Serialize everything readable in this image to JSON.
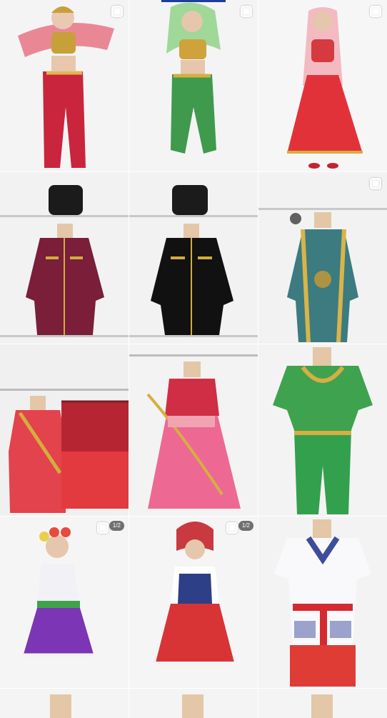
{
  "grid": {
    "tiles": [
      {
        "id": "t1",
        "subject": "girl-red-belly-dance-costume",
        "multi": true,
        "counter": ""
      },
      {
        "id": "t2",
        "subject": "girl-green-belly-dance-costume",
        "multi": true,
        "counter": ""
      },
      {
        "id": "t3",
        "subject": "girl-red-skirt-oriental-costume",
        "multi": true,
        "counter": ""
      },
      {
        "id": "t4",
        "subject": "burgundy-caucasian-coat-with-hat",
        "multi": false,
        "counter": ""
      },
      {
        "id": "t5",
        "subject": "black-caucasian-coat-with-hat",
        "multi": false,
        "counter": ""
      },
      {
        "id": "t6",
        "subject": "teal-gold-embroidered-robe",
        "multi": true,
        "counter": ""
      },
      {
        "id": "t7",
        "subject": "red-dresses-on-rack",
        "multi": false,
        "counter": ""
      },
      {
        "id": "t8",
        "subject": "pink-tulle-dress-mannequin",
        "multi": false,
        "counter": ""
      },
      {
        "id": "t9",
        "subject": "green-sequin-costume",
        "multi": false,
        "counter": ""
      },
      {
        "id": "t10",
        "subject": "girl-ukrainian-purple-skirt",
        "multi": true,
        "counter": "1/2"
      },
      {
        "id": "t11",
        "subject": "girl-russian-red-sarafan",
        "multi": true,
        "counter": "1/2"
      },
      {
        "id": "t12",
        "subject": "embroidered-white-shirt-red-pants",
        "multi": false,
        "counter": ""
      },
      {
        "id": "t13",
        "subject": "partial-row-left",
        "multi": false,
        "counter": ""
      },
      {
        "id": "t14",
        "subject": "partial-row-middle",
        "multi": false,
        "counter": ""
      },
      {
        "id": "t15",
        "subject": "partial-row-right",
        "multi": false,
        "counter": ""
      }
    ]
  },
  "colors": {
    "bg": "#ffffff",
    "tile_bg": "#f1f1f1",
    "accent_top": "#1b3f9c"
  }
}
